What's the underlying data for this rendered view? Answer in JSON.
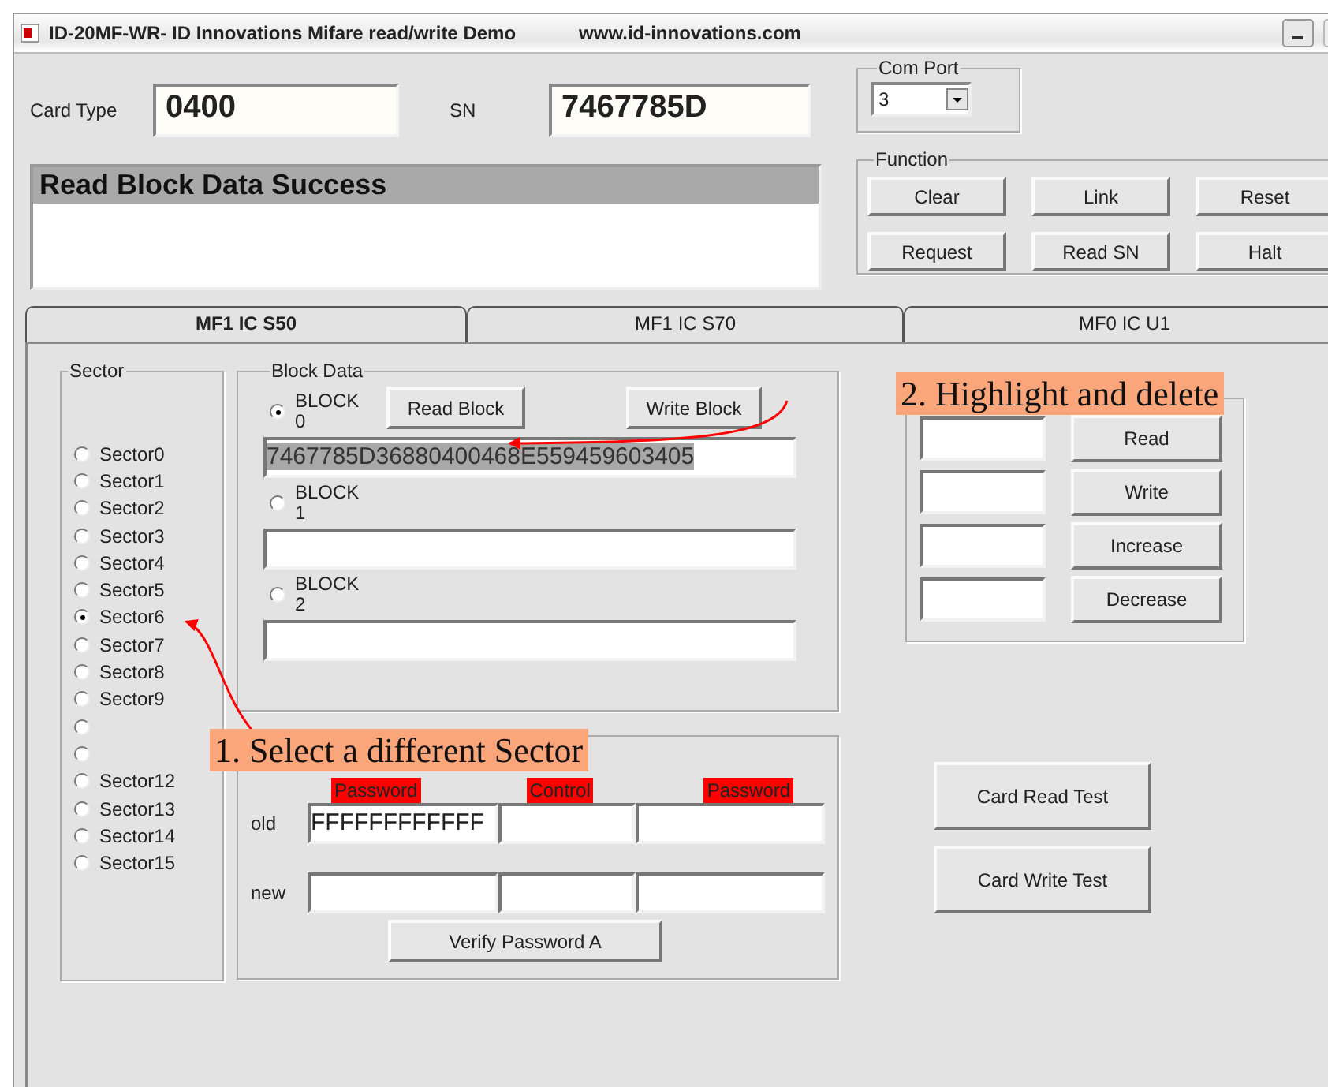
{
  "window": {
    "title": "ID-20MF-WR- ID Innovations Mifare read/write Demo",
    "url": "www.id-innovations.com"
  },
  "card_type": {
    "label": "Card Type",
    "value": "0400"
  },
  "sn": {
    "label": "SN",
    "value": "7467785D"
  },
  "com_port": {
    "label": "Com Port",
    "value": "3"
  },
  "status_message": "Read Block Data Success",
  "function": {
    "label": "Function",
    "buttons": [
      "Clear",
      "Link",
      "Reset",
      "Request",
      "Read SN",
      "Halt"
    ]
  },
  "tabs": [
    {
      "label": "MF1 IC S50",
      "selected": true
    },
    {
      "label": "MF1 IC S70",
      "selected": false
    },
    {
      "label": "MF0 IC U1",
      "selected": false
    }
  ],
  "sector": {
    "label": "Sector",
    "items": [
      {
        "label": "Sector0",
        "selected": false
      },
      {
        "label": "Sector1",
        "selected": false
      },
      {
        "label": "Sector2",
        "selected": false
      },
      {
        "label": "Sector3",
        "selected": false
      },
      {
        "label": "Sector4",
        "selected": false
      },
      {
        "label": "Sector5",
        "selected": false
      },
      {
        "label": "Sector6",
        "selected": true
      },
      {
        "label": "Sector7",
        "selected": false
      },
      {
        "label": "Sector8",
        "selected": false
      },
      {
        "label": "Sector9",
        "selected": false
      },
      {
        "selected": false
      },
      {
        "selected": false
      },
      {
        "label": "Sector12",
        "selected": false
      },
      {
        "label": "Sector13",
        "selected": false
      },
      {
        "label": "Sector14",
        "selected": false
      },
      {
        "label": "Sector15",
        "selected": false
      }
    ]
  },
  "block_data": {
    "label": "Block Data",
    "read_button": "Read Block",
    "write_button": "Write Block",
    "blocks": [
      {
        "label": "BLOCK 0",
        "selected": true,
        "value": "7467785D36880400468E559459603405",
        "highlighted": true
      },
      {
        "label": "BLOCK1",
        "selected": false
      },
      {
        "label": "BLOCK 2",
        "selected": false
      }
    ]
  },
  "value_block": {
    "buttons": [
      "Read",
      "Write",
      "Increase",
      "Decrease"
    ]
  },
  "password": {
    "columns": [
      "Password",
      "Control",
      "Password"
    ],
    "rows": [
      {
        "label": "old",
        "key_a": "FFFFFFFFFFFF"
      },
      {
        "label": "new"
      }
    ],
    "verify_button": "Verify Password A"
  },
  "test_buttons": [
    "Card Read Test",
    "Card Write Test"
  ],
  "annotations": [
    "1. Select a different Sector",
    "2. Highlight and delete"
  ]
}
